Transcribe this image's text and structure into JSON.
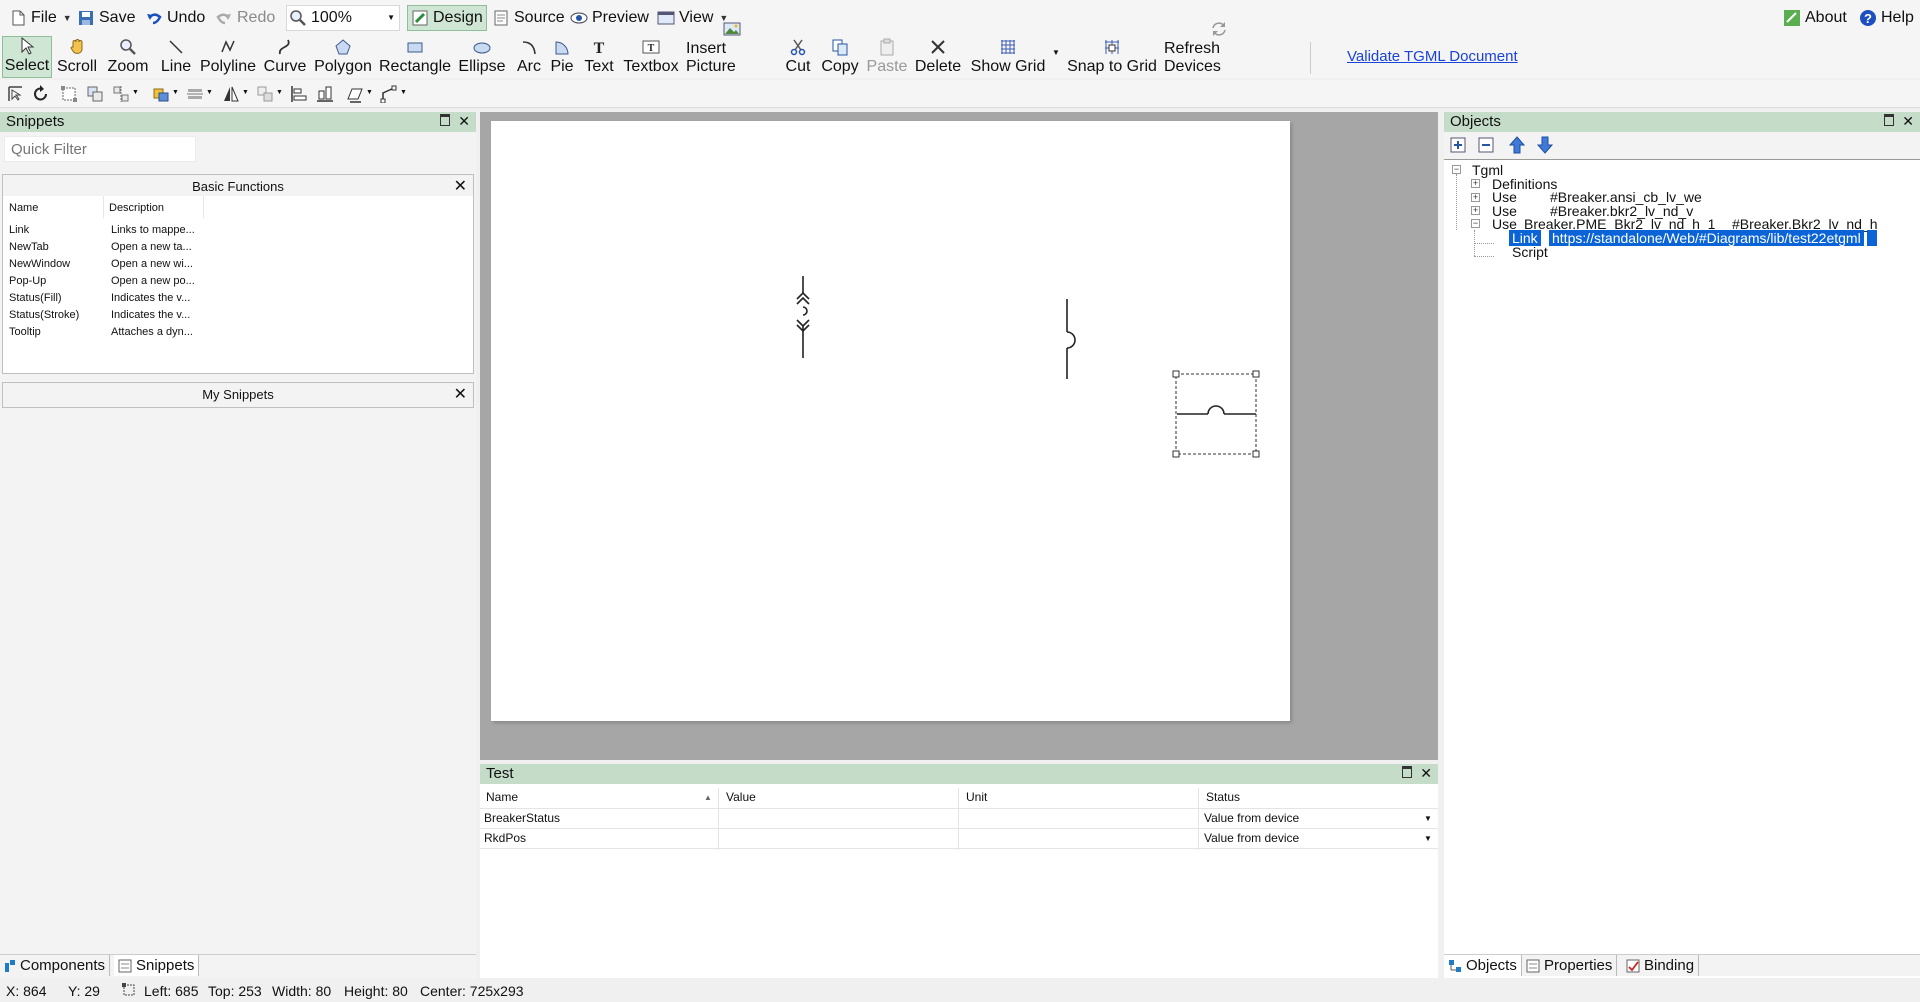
{
  "menubar": {
    "file": "File",
    "save": "Save",
    "undo": "Undo",
    "redo": "Redo",
    "zoom": "100%",
    "design": "Design",
    "source": "Source",
    "preview": "Preview",
    "view": "View",
    "about": "About",
    "help": "Help"
  },
  "toolbar": {
    "select": "Select",
    "scroll": "Scroll",
    "zoom": "Zoom",
    "line": "Line",
    "polyline": "Polyline",
    "curve": "Curve",
    "polygon": "Polygon",
    "rectangle": "Rectangle",
    "ellipse": "Ellipse",
    "arc": "Arc",
    "pie": "Pie",
    "text": "Text",
    "textbox": "Textbox",
    "insert_picture": "Insert Picture",
    "cut": "Cut",
    "copy": "Copy",
    "paste": "Paste",
    "delete": "Delete",
    "show_grid": "Show Grid",
    "snap_to_grid": "Snap to Grid",
    "refresh_devices": "Refresh Devices",
    "validate": "Validate TGML Document"
  },
  "snippets": {
    "title": "Snippets",
    "quick_filter_placeholder": "Quick Filter",
    "basic_functions": "Basic Functions",
    "col_name": "Name",
    "col_description": "Description",
    "items": [
      {
        "name": "Link",
        "description": "Links to mappe..."
      },
      {
        "name": "NewTab",
        "description": "Open a new ta..."
      },
      {
        "name": "NewWindow",
        "description": "Open a new wi..."
      },
      {
        "name": "Pop-Up",
        "description": "Open a new po..."
      },
      {
        "name": "Status(Fill)",
        "description": "Indicates the v..."
      },
      {
        "name": "Status(Stroke)",
        "description": "Indicates the v..."
      },
      {
        "name": "Tooltip",
        "description": "Attaches a dyn..."
      }
    ],
    "my_snippets": "My Snippets"
  },
  "left_tabs": {
    "components": "Components",
    "snippets": "Snippets"
  },
  "test": {
    "title": "Test",
    "columns": [
      "Name",
      "Value",
      "Unit",
      "Status"
    ],
    "rows": [
      {
        "name": "BreakerStatus",
        "value": "",
        "unit": "",
        "status": "Value from device"
      },
      {
        "name": "RkdPos",
        "value": "",
        "unit": "",
        "status": "Value from device"
      }
    ]
  },
  "objects": {
    "title": "Objects",
    "tree": {
      "root": "Tgml",
      "definitions": "Definitions",
      "use1_type": "Use",
      "use1_ref": "#Breaker.ansi_cb_lv_we",
      "use2_type": "Use",
      "use2_ref": "#Breaker.bkr2_lv_nd_v",
      "use3_type": "Use",
      "use3_name": "Breaker.PME_Bkr2_lv_nd_h_1",
      "use3_ref": "#Breaker.Bkr2_lv_nd_h",
      "link_label": "Link",
      "link_value": "https://standalone/Web/#Diagrams/lib/test22etgml",
      "script": "Script"
    }
  },
  "right_tabs": {
    "objects": "Objects",
    "properties": "Properties",
    "binding": "Binding"
  },
  "statusbar": {
    "x": "X: 864",
    "y": "Y: 29",
    "left": "Left: 685",
    "top": "Top: 253",
    "width": "Width: 80",
    "height": "Height: 80",
    "center": "Center: 725x293"
  }
}
